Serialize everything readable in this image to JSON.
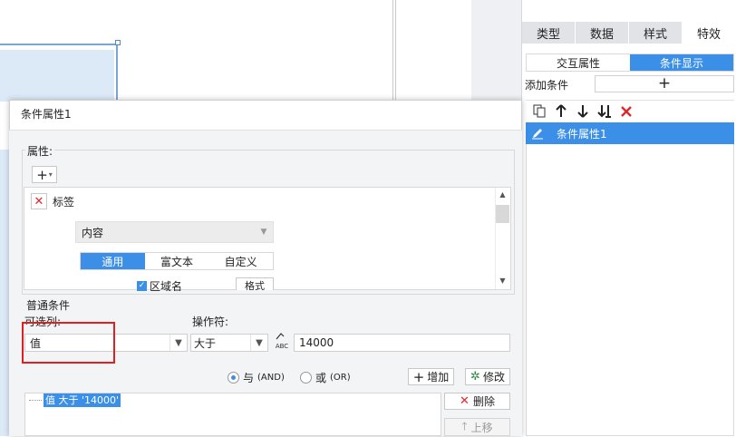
{
  "right_panel": {
    "tabs": [
      "类型",
      "数据",
      "样式",
      "特效"
    ],
    "active_tab": 3,
    "subtabs": [
      "交互属性",
      "条件显示"
    ],
    "active_subtab": 1,
    "add_condition_label": "添加条件",
    "add_condition_icon": "+",
    "toolbar_icons": [
      "copy-icon",
      "arrow-up-icon",
      "arrow-down-icon",
      "move-bottom-icon",
      "delete-icon"
    ],
    "conditions": [
      {
        "label": "条件属性1"
      }
    ]
  },
  "dialog": {
    "title": "条件属性1",
    "attributes": {
      "legend": "属性:",
      "add_symbol": "+",
      "item_label": "标签",
      "content_select": "内容",
      "segments": [
        "通用",
        "富文本",
        "自定义"
      ],
      "active_segment": 0,
      "region_label": "区域名",
      "format_button": "格式"
    },
    "normal_condition": {
      "section_label": "普通条件",
      "column_label": "可选列:",
      "operator_label": "操作符:",
      "column_value": "值",
      "operator_value": "大于",
      "value_input": "14000",
      "abc_text": "ABC"
    },
    "logic": {
      "and_label": "与",
      "and_suffix": "(AND)",
      "or_label": "或",
      "or_suffix": "(OR)",
      "selected": "and"
    },
    "buttons": {
      "add": "增加",
      "edit": "修改",
      "delete": "删除",
      "move_up": "上移"
    },
    "condition_tree": [
      "值 大于 '14000'"
    ]
  },
  "colors": {
    "accent": "#3c8fe6",
    "highlight_box": "#e02020",
    "delete_red": "#e0262a"
  }
}
